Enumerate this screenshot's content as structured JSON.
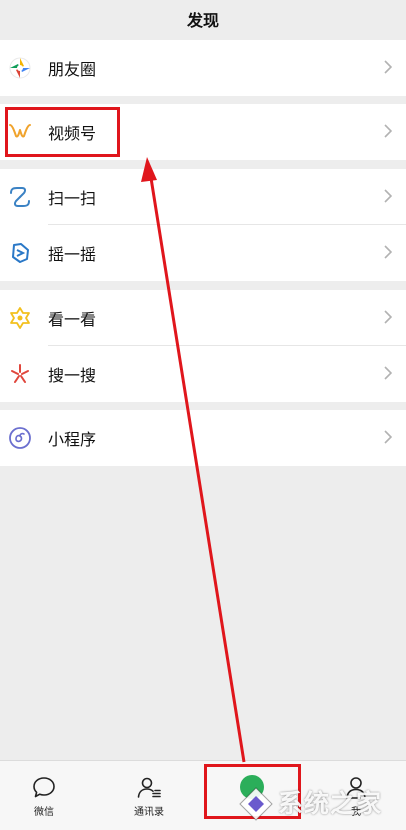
{
  "header": {
    "title": "发现"
  },
  "groups": [
    {
      "items": [
        {
          "label": "朋友圈",
          "icon": "moments-icon"
        }
      ]
    },
    {
      "items": [
        {
          "label": "视频号",
          "icon": "channels-icon"
        }
      ]
    },
    {
      "items": [
        {
          "label": "扫一扫",
          "icon": "scan-icon"
        },
        {
          "label": "摇一摇",
          "icon": "shake-icon"
        }
      ]
    },
    {
      "items": [
        {
          "label": "看一看",
          "icon": "top-stories-icon"
        },
        {
          "label": "搜一搜",
          "icon": "search-icon"
        }
      ]
    },
    {
      "items": [
        {
          "label": "小程序",
          "icon": "mini-programs-icon"
        }
      ]
    }
  ],
  "tabbar": {
    "tabs": [
      {
        "label": "微信",
        "icon": "chats-icon"
      },
      {
        "label": "通讯录",
        "icon": "contacts-icon"
      },
      {
        "label": "",
        "icon": "discover-icon",
        "selected": true
      },
      {
        "label": "我",
        "icon": "me-icon"
      }
    ]
  },
  "watermark": {
    "text": "系统之家"
  },
  "colors": {
    "background": "#ededed",
    "annotation_red": "#e0161c",
    "wechat_green": "#2bae5a"
  }
}
